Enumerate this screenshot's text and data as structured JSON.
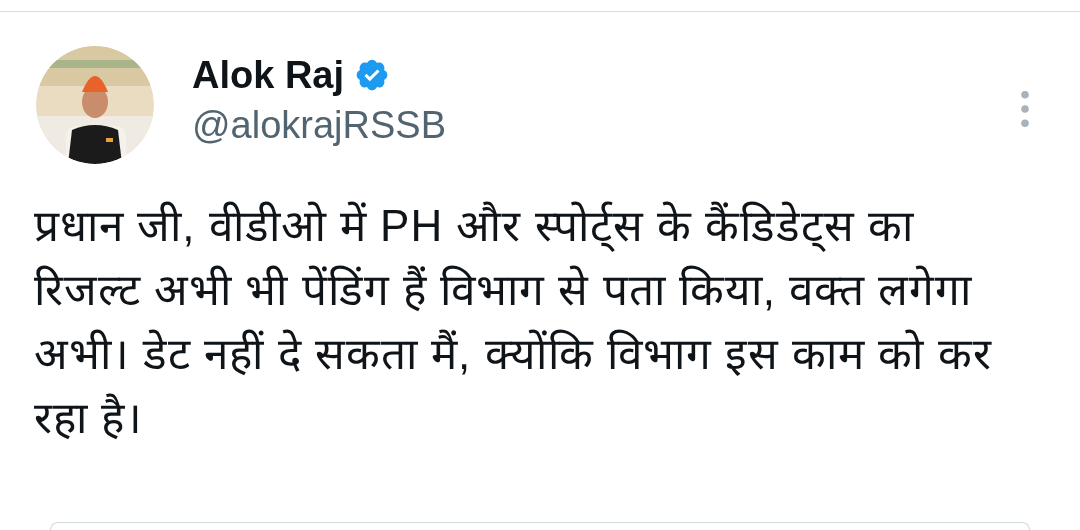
{
  "author": {
    "name": "Alok Raj",
    "verified": true,
    "handle": "@alokrajRSSB"
  },
  "tweet": {
    "text": "प्रधान जी, वीडीओ में PH और स्पोर्ट्स के कैंडिडेट्स का रिजल्ट अभी भी पेंडिंग हैं विभाग से पता किया, वक्त लगेगा अभी। डेट नहीं दे सकता मैं, क्योंकि विभाग इस काम को कर रहा है।"
  }
}
